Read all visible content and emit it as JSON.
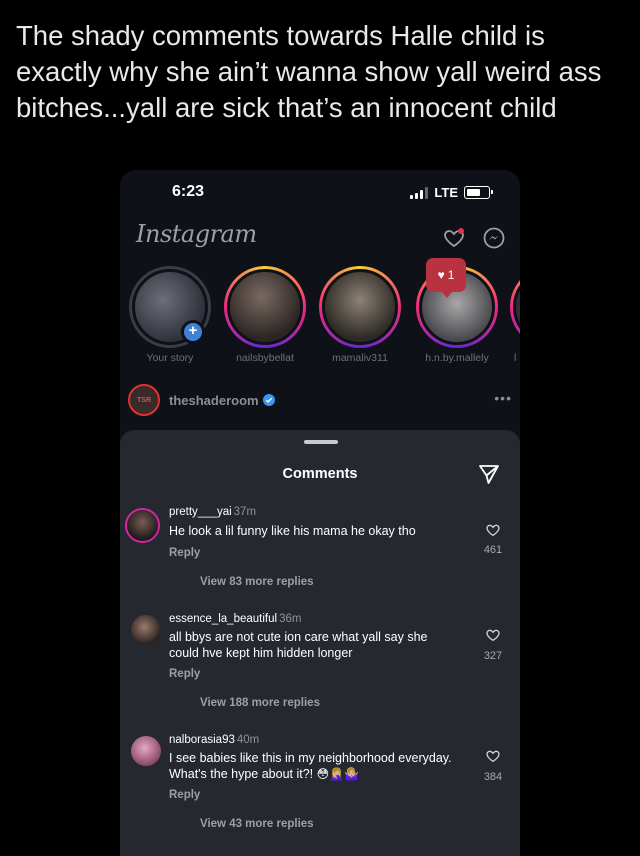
{
  "tweet": {
    "text": "The shady comments towards Halle child is exactly why she ain’t wanna show yall weird ass bitches...yall are sick that’s an innocent child"
  },
  "status_bar": {
    "time": "6:23",
    "network": "LTE"
  },
  "app": {
    "logo": "Instagram",
    "icons": [
      "heart-icon",
      "messenger-icon"
    ]
  },
  "stories": [
    {
      "label": "Your story",
      "has_add": true
    },
    {
      "label": "nailsbybellat"
    },
    {
      "label": "mamaliv311"
    },
    {
      "label": "h.n.by.mallely"
    },
    {
      "label": "l"
    }
  ],
  "notification_badge": {
    "count": "1"
  },
  "post": {
    "username": "theshaderoom",
    "avatar_text": "TSR",
    "verified": true
  },
  "comments_sheet": {
    "title": "Comments",
    "comments": [
      {
        "username": "pretty___yai",
        "time": "37m",
        "text": "He look a lil funny like his mama he okay tho",
        "reply_label": "Reply",
        "likes": "461",
        "more_replies": "View 83 more replies"
      },
      {
        "username": "essence_la_beautiful",
        "time": "36m",
        "text": "all bbys are not cute ion care what yall say she could hve kept him hidden longer",
        "reply_label": "Reply",
        "likes": "327",
        "more_replies": "View 188 more replies"
      },
      {
        "username": "nalborasia93",
        "time": "40m",
        "text": "I see babies like this in my neighborhood everyday. What's the hype about it?!",
        "emojis": "😳🤦🏼‍♀️🤷🏼‍♀️",
        "reply_label": "Reply",
        "likes": "384",
        "more_replies": "View 43 more replies"
      }
    ]
  },
  "colors": {
    "background": "#000000",
    "phone_bg": "#0e1117",
    "sheet_bg": "#25282e",
    "story_ring_gradient": [
      "#f9ce34",
      "#ee2a7b",
      "#6228d7"
    ],
    "verified_blue": "#3897f0",
    "notification_red": "#b8323f"
  }
}
